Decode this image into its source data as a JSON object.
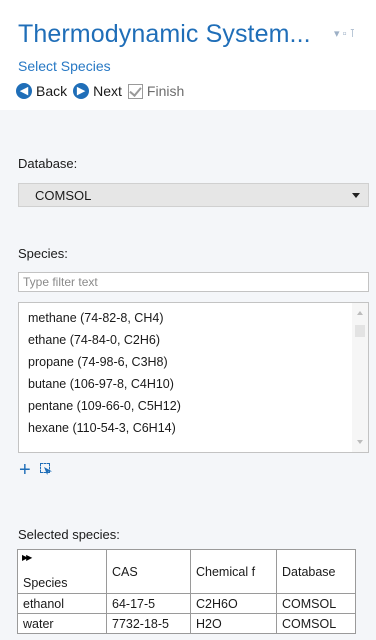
{
  "header": {
    "title": "Thermodynamic System...",
    "window_controls": "▾ ▫ ⊺",
    "subtitle": "Select Species",
    "back_label": "Back",
    "next_label": "Next",
    "finish_label": "Finish"
  },
  "database": {
    "label": "Database:",
    "selected": "COMSOL"
  },
  "species": {
    "label": "Species:",
    "filter_placeholder": "Type filter text",
    "items": [
      "methane (74-82-8, CH4)",
      "ethane (74-84-0, C2H6)",
      "propane (74-98-6, C3H8)",
      "butane (106-97-8, C4H10)",
      "pentane (109-66-0, C5H12)",
      "hexane (110-54-3, C6H14)"
    ]
  },
  "selected": {
    "label": "Selected species:",
    "columns": [
      "Species",
      "CAS",
      "Chemical f",
      "Database"
    ],
    "rows": [
      [
        "ethanol",
        "64-17-5",
        "C2H6O",
        "COMSOL"
      ],
      [
        "water",
        "7732-18-5",
        "H2O",
        "COMSOL"
      ]
    ]
  },
  "colors": {
    "accent": "#1f6eb8",
    "panel_background": "#f4f6f9"
  },
  "icons": [
    "back-arrow-icon",
    "next-arrow-icon",
    "finish-check-icon",
    "dropdown-arrow-icon",
    "add-icon",
    "add-selection-icon",
    "expand-icon"
  ]
}
